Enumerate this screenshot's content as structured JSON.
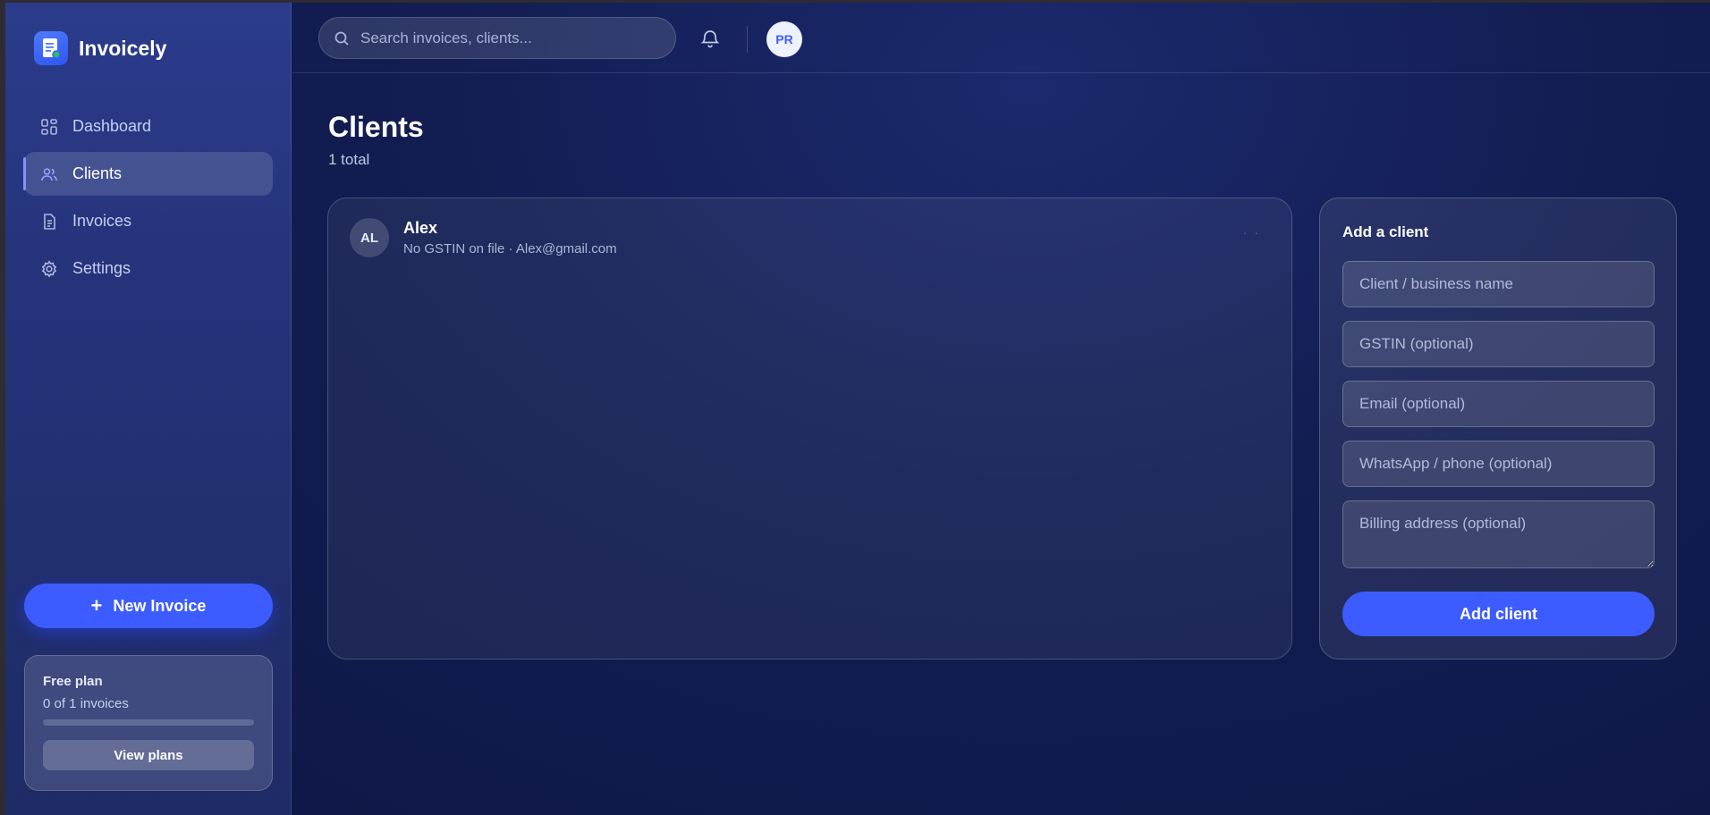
{
  "app": {
    "name": "Invoicely"
  },
  "sidebar": {
    "items": [
      {
        "label": "Dashboard",
        "icon": "grid-icon",
        "active": false
      },
      {
        "label": "Clients",
        "icon": "users-icon",
        "active": true
      },
      {
        "label": "Invoices",
        "icon": "document-icon",
        "active": false
      },
      {
        "label": "Settings",
        "icon": "gear-icon",
        "active": false
      }
    ],
    "new_invoice_label": "New Invoice",
    "new_invoice_icon": "+",
    "plan": {
      "title": "Free plan",
      "usage": "0 of 1 invoices",
      "progress": 0,
      "button_label": "View plans"
    }
  },
  "topbar": {
    "search_placeholder": "Search invoices, clients...",
    "avatar_initials": "PR"
  },
  "main": {
    "title": "Clients",
    "count": "1 total",
    "clients": [
      {
        "initials": "AL",
        "name": "Alex",
        "meta": "No GSTIN on file · Alex@gmail.com",
        "more": "· ·"
      }
    ]
  },
  "add_client": {
    "title": "Add a client",
    "fields": {
      "name": "Client / business name",
      "gstin": "GSTIN (optional)",
      "email": "Email (optional)",
      "phone": "WhatsApp / phone (optional)",
      "address": "Billing address (optional)"
    },
    "button_label": "Add client"
  },
  "colors": {
    "accent": "#3d5cff",
    "sidebar_bg": "#2b3c8c",
    "main_bg": "#131d52"
  }
}
